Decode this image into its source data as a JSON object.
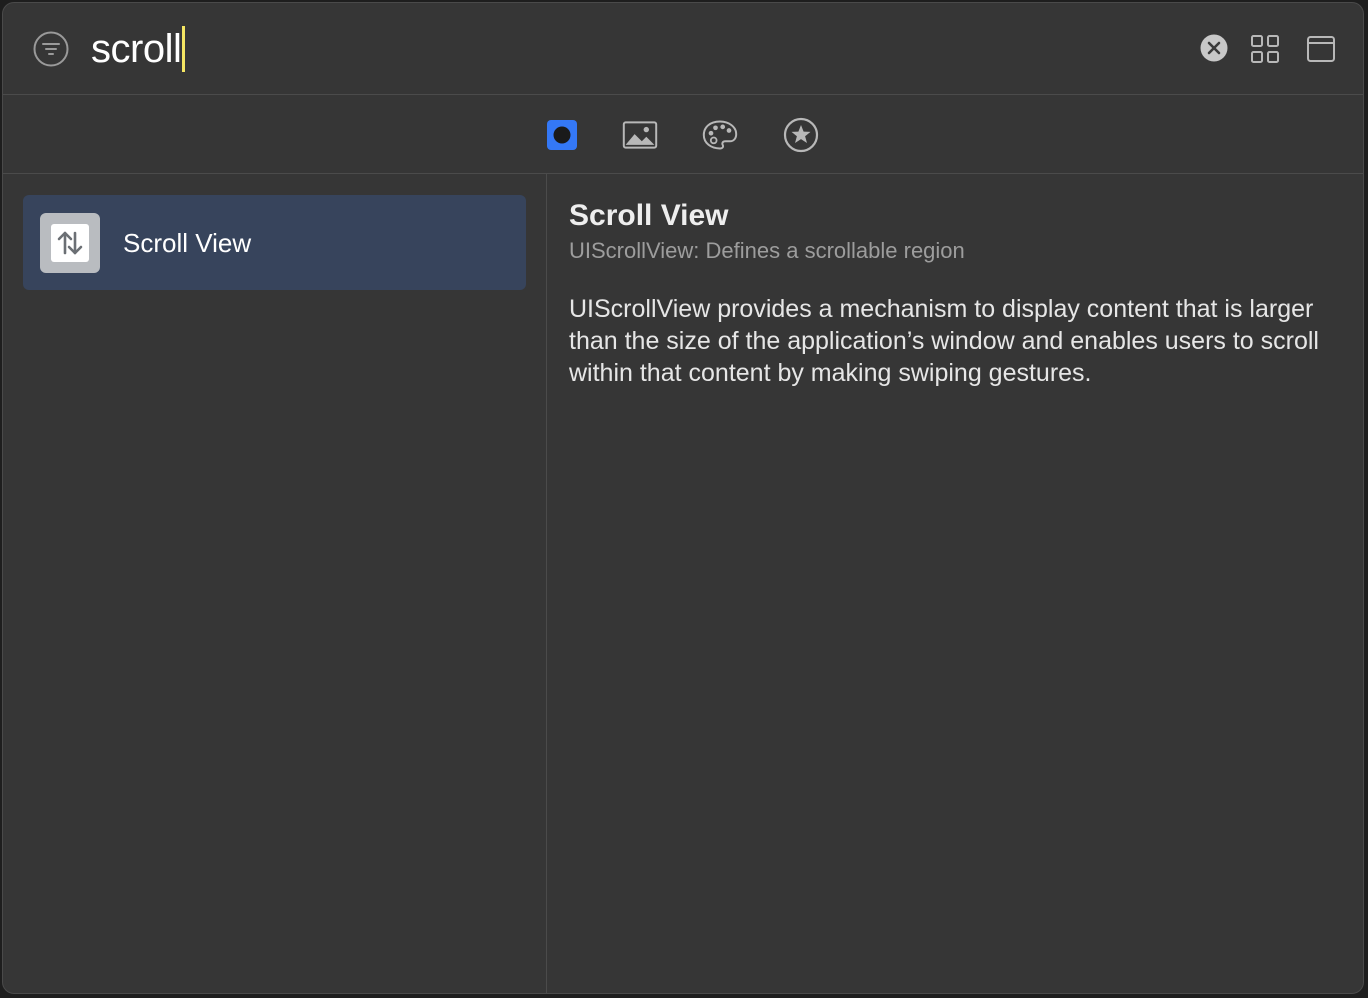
{
  "search": {
    "query": "scroll"
  },
  "icons": {
    "filter": "filter-icon",
    "clear": "clear-icon",
    "grid_view": "grid-icon",
    "window": "window-icon",
    "result": "scroll-arrows-icon"
  },
  "tabs": [
    {
      "name": "objects",
      "icon": "objects-icon",
      "selected": true
    },
    {
      "name": "media",
      "icon": "image-icon",
      "selected": false
    },
    {
      "name": "colors",
      "icon": "palette-icon",
      "selected": false
    },
    {
      "name": "favorites",
      "icon": "star-icon",
      "selected": false
    }
  ],
  "results": [
    {
      "label": "Scroll View",
      "selected": true
    }
  ],
  "detail": {
    "title": "Scroll View",
    "subtitle": "UIScrollView: Defines a scrollable region",
    "description": "UIScrollView provides a mechanism to display content that is larger than the size of the application’s window and enables users to scroll within that content by making swiping gestures."
  },
  "colors": {
    "background": "#363636",
    "selection": "#37445c",
    "accent": "#3478f6",
    "caret": "#f5e663"
  }
}
